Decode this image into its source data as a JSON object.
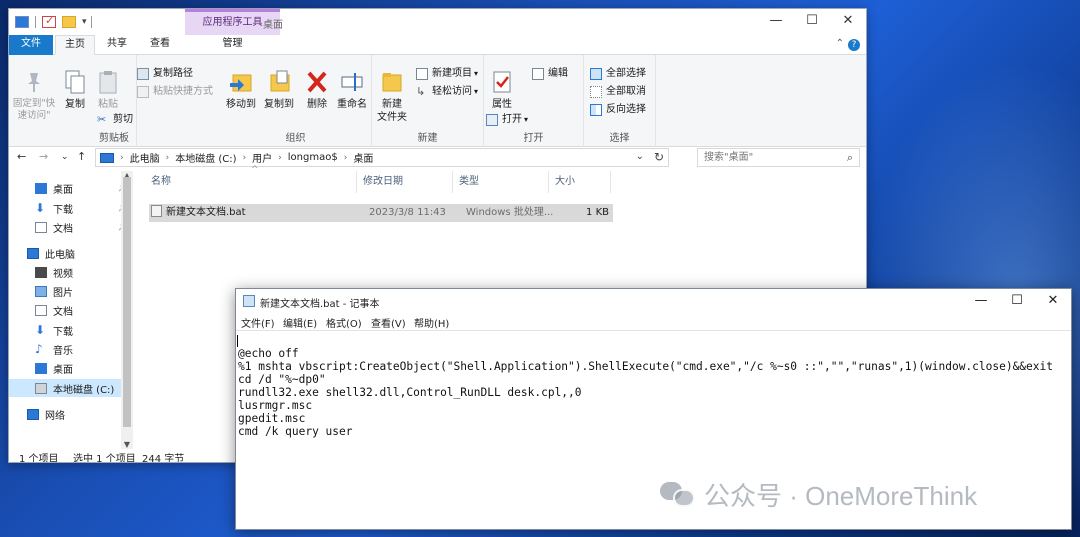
{
  "explorer": {
    "title": "桌面",
    "context_tab": "应用程序工具",
    "tabs": [
      "文件",
      "主页",
      "共享",
      "查看",
      "管理"
    ],
    "ribbon": {
      "clipboard": {
        "label": "剪贴板",
        "pin": "固定到\"快速访问\"",
        "copy": "复制",
        "paste": "粘贴",
        "copy_path": "复制路径",
        "paste_shortcut": "粘贴快捷方式",
        "cut": "剪切"
      },
      "organize": {
        "label": "组织",
        "move_to": "移动到",
        "copy_to": "复制到",
        "delete": "删除",
        "rename": "重命名"
      },
      "new": {
        "label": "新建",
        "new_folder": "新建\n文件夹",
        "new_item": "新建项目",
        "easy_access": "轻松访问"
      },
      "open": {
        "label": "打开",
        "properties": "属性",
        "open": "打开",
        "edit": "编辑"
      },
      "select": {
        "label": "选择",
        "select_all": "全部选择",
        "select_none": "全部取消",
        "invert": "反向选择"
      }
    },
    "address": {
      "crumbs": [
        "此电脑",
        "本地磁盘 (C:)",
        "用户",
        "longmao$",
        "桌面"
      ],
      "search_placeholder": "搜索\"桌面\""
    },
    "nav_items": [
      {
        "label": "桌面",
        "pinned": true
      },
      {
        "label": "下载",
        "pinned": true
      },
      {
        "label": "文档",
        "pinned": true
      },
      {
        "label": "此电脑"
      },
      {
        "label": "视频"
      },
      {
        "label": "图片"
      },
      {
        "label": "文档"
      },
      {
        "label": "下载"
      },
      {
        "label": "音乐"
      },
      {
        "label": "桌面"
      },
      {
        "label": "本地磁盘 (C:)"
      },
      {
        "label": "网络"
      }
    ],
    "columns": [
      "名称",
      "修改日期",
      "类型",
      "大小"
    ],
    "files": [
      {
        "name": "新建文本文档.bat",
        "modified": "2023/3/8 11:43",
        "type": "Windows 批处理...",
        "size": "1 KB"
      }
    ],
    "status": {
      "count": "1 个项目",
      "selected": "选中 1 个项目",
      "bytes": "244 字节"
    }
  },
  "notepad": {
    "title": "新建文本文档.bat - 记事本",
    "menu": [
      "文件(F)",
      "编辑(E)",
      "格式(O)",
      "查看(V)",
      "帮助(H)"
    ],
    "lines": [
      "@echo off",
      "%1 mshta vbscript:CreateObject(\"Shell.Application\").ShellExecute(\"cmd.exe\",\"/c %~s0 ::\",\"\",\"runas\",1)(window.close)&&exit",
      "cd /d \"%~dp0\"",
      "rundll32.exe shell32.dll,Control_RunDLL desk.cpl,,0",
      "lusrmgr.msc",
      "gpedit.msc",
      "cmd /k query user"
    ]
  },
  "watermark": {
    "text": "公众号 · OneMoreThink"
  }
}
